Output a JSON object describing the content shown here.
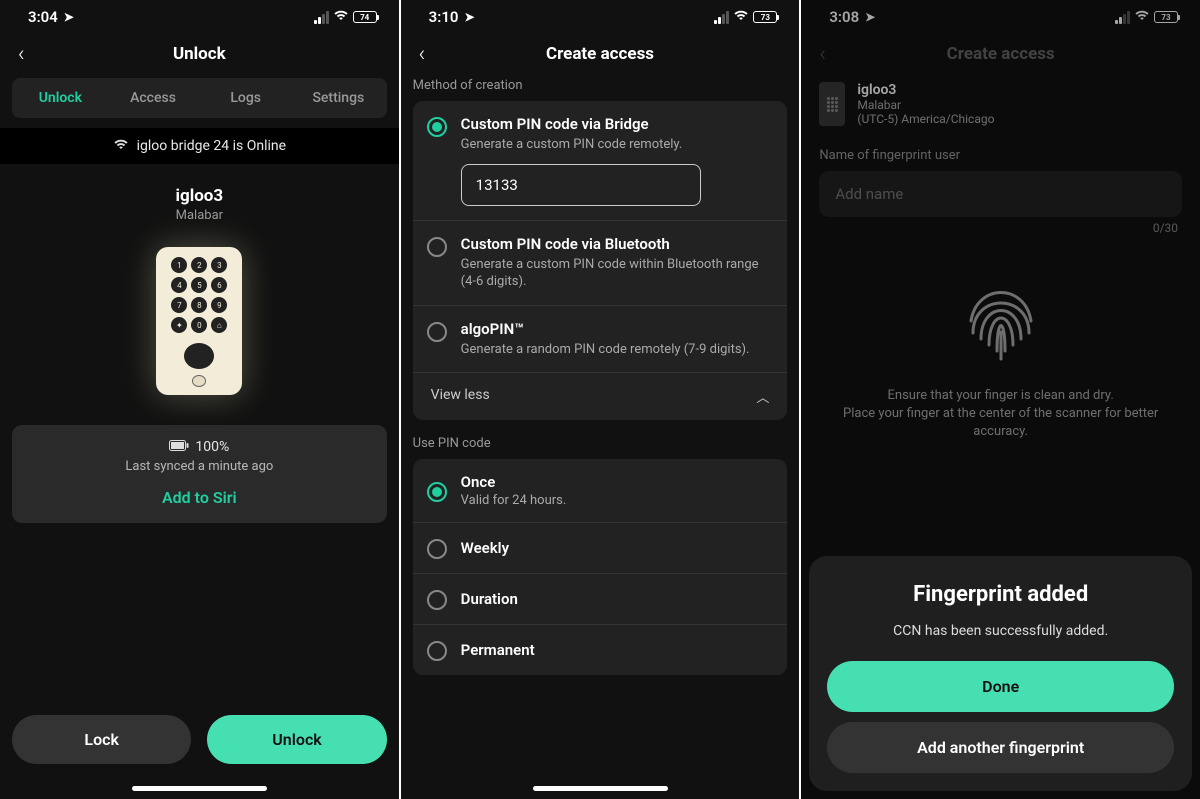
{
  "screen1": {
    "status": {
      "time": "3:04",
      "battery": "74"
    },
    "title": "Unlock",
    "tabs": [
      "Unlock",
      "Access",
      "Logs",
      "Settings"
    ],
    "activeTab": 0,
    "bridgeStatus": "igloo bridge 24 is Online",
    "deviceName": "igloo3",
    "deviceLocation": "Malabar",
    "batteryPct": "100%",
    "lastSynced": "Last synced a minute ago",
    "siri": "Add to Siri",
    "lockLabel": "Lock",
    "unlockLabel": "Unlock"
  },
  "screen2": {
    "status": {
      "time": "3:10",
      "battery": "73"
    },
    "title": "Create access",
    "methodLabel": "Method of creation",
    "opts": [
      {
        "title": "Custom PIN code via Bridge",
        "desc": "Generate a custom PIN code remotely.",
        "selected": true,
        "pin": "13133"
      },
      {
        "title": "Custom PIN code via Bluetooth",
        "desc": "Generate a custom PIN code within Bluetooth range (4-6 digits).",
        "selected": false
      },
      {
        "title": "algoPIN™",
        "desc": "Generate a random PIN code remotely (7-9 digits).",
        "selected": false
      }
    ],
    "viewLess": "View less",
    "usePinLabel": "Use PIN code",
    "useOptions": [
      {
        "title": "Once",
        "sub": "Valid for 24 hours.",
        "selected": true
      },
      {
        "title": "Weekly",
        "selected": false
      },
      {
        "title": "Duration",
        "selected": false
      },
      {
        "title": "Permanent",
        "selected": false
      }
    ]
  },
  "screen3": {
    "status": {
      "time": "3:08",
      "battery": "73"
    },
    "title": "Create access",
    "device": {
      "name": "igloo3",
      "location": "Malabar",
      "tz": "(UTC-5) America/Chicago"
    },
    "nameLabel": "Name of fingerprint user",
    "namePlaceholder": "Add name",
    "charCount": "0/30",
    "helpLine1": "Ensure that your finger is clean and dry.",
    "helpLine2": "Place your finger at the center of the scanner for better accuracy.",
    "sheet": {
      "title": "Fingerprint added",
      "body": "CCN has been successfully added.",
      "done": "Done",
      "another": "Add another fingerprint"
    }
  }
}
